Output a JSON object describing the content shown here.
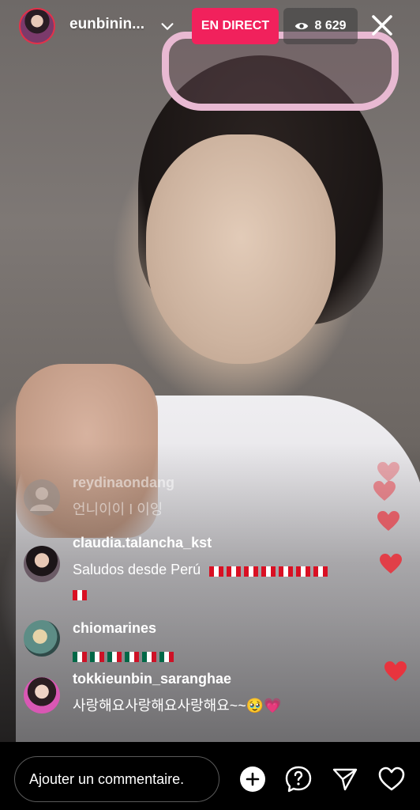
{
  "header": {
    "host_username": "eunbinin...",
    "live_label": "EN DIRECT",
    "viewer_count": "8 629"
  },
  "comments": [
    {
      "username": "reydinaondang",
      "text": "언니이이 I 이잉",
      "faded": true
    },
    {
      "username": "claudia.talancha_kst",
      "text": "Saludos desde Perú",
      "flags": "pe"
    },
    {
      "username": "chiomarines",
      "text": "",
      "flags": "mx"
    },
    {
      "username": "tokkieunbin_saranghae",
      "text": "사랑해요사랑해요사랑해요~~🥹💗"
    }
  ],
  "composer": {
    "placeholder": "Ajouter un commentaire."
  },
  "colors": {
    "live_badge": "#f1215c",
    "heart": "#e8343e"
  }
}
